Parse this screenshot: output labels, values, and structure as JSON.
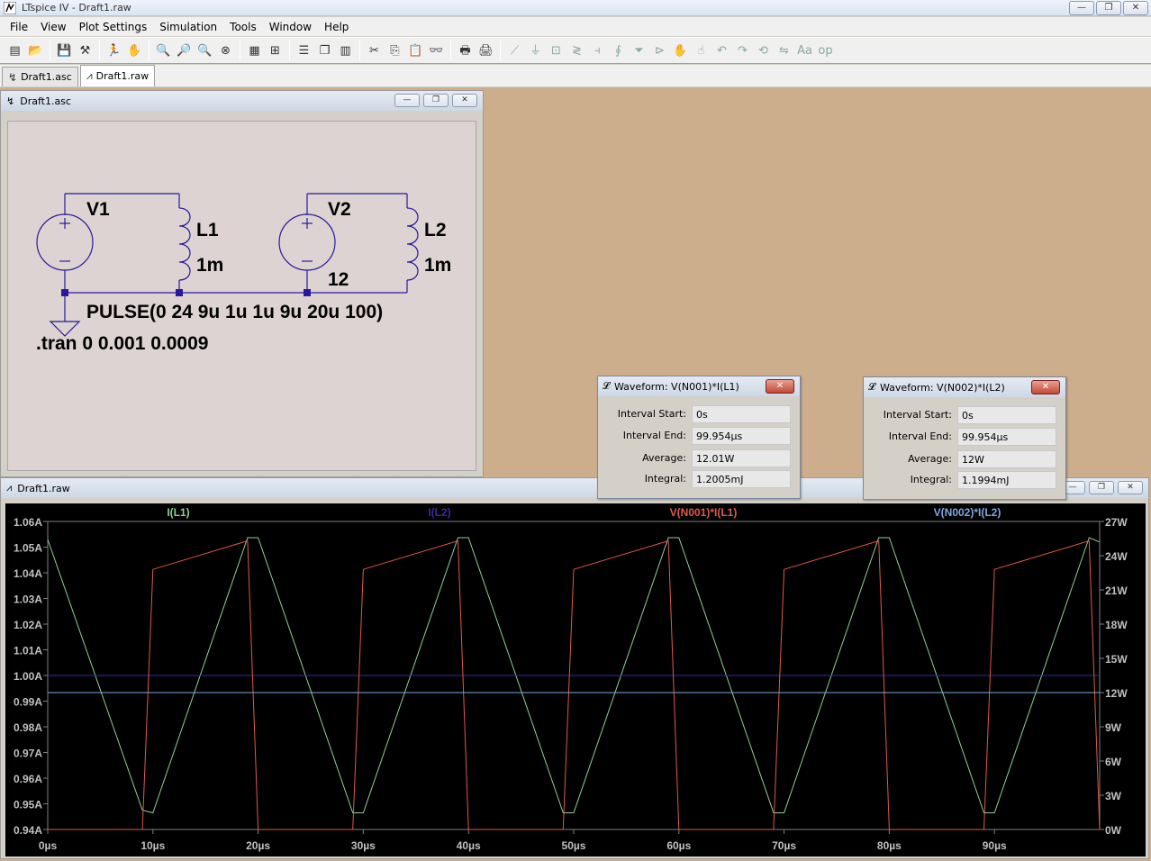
{
  "app": {
    "title": "LTspice IV - Draft1.raw",
    "window_buttons": [
      "—",
      "❐",
      "✕"
    ]
  },
  "menu": {
    "items": [
      "File",
      "View",
      "Plot Settings",
      "Simulation",
      "Tools",
      "Window",
      "Help"
    ]
  },
  "toolbar": {
    "icons": [
      {
        "name": "new-schematic-icon",
        "glyph": "▤"
      },
      {
        "name": "open-icon",
        "glyph": "📂"
      },
      {
        "name": "save-icon",
        "glyph": "💾"
      },
      {
        "name": "control-panel-icon",
        "glyph": "⚒"
      },
      {
        "name": "run-icon",
        "glyph": "🏃"
      },
      {
        "name": "pan-icon",
        "glyph": "✋"
      },
      {
        "name": "zoom-in-icon",
        "glyph": "🔍"
      },
      {
        "name": "zoom-area-icon",
        "glyph": "🔎"
      },
      {
        "name": "zoom-out-icon",
        "glyph": "🔍"
      },
      {
        "name": "zoom-fit-icon",
        "glyph": "⊗"
      },
      {
        "name": "autorange-icon",
        "glyph": "▦"
      },
      {
        "name": "manual-limits-icon",
        "glyph": "⊞"
      },
      {
        "name": "tile-horizontal-icon",
        "glyph": "☰"
      },
      {
        "name": "cascade-icon",
        "glyph": "❐"
      },
      {
        "name": "tile-vertical-icon",
        "glyph": "▥"
      },
      {
        "name": "cut-icon",
        "glyph": "✂"
      },
      {
        "name": "copy-icon",
        "glyph": "⎘"
      },
      {
        "name": "paste-icon",
        "glyph": "📋"
      },
      {
        "name": "find-icon",
        "glyph": "👓"
      },
      {
        "name": "print-setup-icon",
        "glyph": "🖶"
      },
      {
        "name": "print-icon",
        "glyph": "🖨"
      },
      {
        "name": "wire-icon",
        "glyph": "⟋"
      },
      {
        "name": "ground-icon",
        "glyph": "⏚"
      },
      {
        "name": "label-net-icon",
        "glyph": "⊡"
      },
      {
        "name": "resistor-icon",
        "glyph": "≷"
      },
      {
        "name": "capacitor-icon",
        "glyph": "⫞"
      },
      {
        "name": "inductor-icon",
        "glyph": "∮"
      },
      {
        "name": "diode-icon",
        "glyph": "⏷"
      },
      {
        "name": "component-icon",
        "glyph": "⊳"
      },
      {
        "name": "move-icon",
        "glyph": "✋"
      },
      {
        "name": "drag-icon",
        "glyph": "☝"
      },
      {
        "name": "undo-icon",
        "glyph": "↶"
      },
      {
        "name": "redo-icon",
        "glyph": "↷"
      },
      {
        "name": "rotate-icon",
        "glyph": "⟲"
      },
      {
        "name": "mirror-icon",
        "glyph": "⇋"
      },
      {
        "name": "text-icon",
        "glyph": "Aa"
      },
      {
        "name": "spice-directive-icon",
        "glyph": "op"
      }
    ]
  },
  "tabs": [
    {
      "label": "Draft1.asc",
      "active": false
    },
    {
      "label": "Draft1.raw",
      "active": true
    }
  ],
  "schematic_window": {
    "title": "Draft1.asc",
    "labels": {
      "v1": "V1",
      "l1": "L1",
      "l1_value": "1m",
      "v2": "V2",
      "v2_value": "12",
      "l2": "L2",
      "l2_value": "1m",
      "pulse": "PULSE(0 24 9u 1u 1u 9u 20u 100)",
      "tran": ".tran 0 0.001 0.0009"
    }
  },
  "plot_window": {
    "title": "Draft1.raw",
    "colors": {
      "background": "#000000",
      "axis_text": "#c0c0c0",
      "i_l1": "#90d098",
      "i_l2": "#3a2aa0",
      "p1": "#e05a48",
      "p2": "#7ea8e0"
    }
  },
  "measure_dialogs": [
    {
      "title": "Waveform: V(N001)*I(L1)",
      "rows": [
        {
          "label": "Interval Start:",
          "value": "0s"
        },
        {
          "label": "Interval End:",
          "value": "99.954µs"
        },
        {
          "label": "Average:",
          "value": "12.01W"
        },
        {
          "label": "Integral:",
          "value": "1.2005mJ"
        }
      ]
    },
    {
      "title": "Waveform: V(N002)*I(L2)",
      "rows": [
        {
          "label": "Interval Start:",
          "value": "0s"
        },
        {
          "label": "Interval End:",
          "value": "99.954µs"
        },
        {
          "label": "Average:",
          "value": "12W"
        },
        {
          "label": "Integral:",
          "value": "1.1994mJ"
        }
      ]
    }
  ],
  "chart_data": {
    "type": "line",
    "title": "",
    "xlabel": "",
    "ylabel": "",
    "x_ticks": [
      "0µs",
      "10µs",
      "20µs",
      "30µs",
      "40µs",
      "50µs",
      "60µs",
      "70µs",
      "80µs",
      "90µs"
    ],
    "y_left_ticks": [
      "1.06A",
      "1.05A",
      "1.04A",
      "1.03A",
      "1.02A",
      "1.01A",
      "1.00A",
      "0.99A",
      "0.98A",
      "0.97A",
      "0.96A",
      "0.95A",
      "0.94A"
    ],
    "y_right_ticks": [
      "27W",
      "24W",
      "21W",
      "18W",
      "15W",
      "12W",
      "9W",
      "6W",
      "3W",
      "0W"
    ],
    "xlim_us": [
      0,
      100
    ],
    "ylim_left_A": [
      0.94,
      1.06
    ],
    "ylim_right_W": [
      0,
      27
    ],
    "legend_placement": "top",
    "series": [
      {
        "name": "I(L1)",
        "axis": "left",
        "unit": "A",
        "x_us": [
          0,
          9,
          10,
          19,
          20,
          29,
          30,
          39,
          40,
          49,
          50,
          59,
          60,
          69,
          70,
          79,
          80,
          89,
          90,
          99,
          100
        ],
        "values": [
          1.053,
          0.9475,
          0.9465,
          1.0537,
          1.0537,
          0.9465,
          0.9465,
          1.0537,
          1.0537,
          0.9465,
          0.9465,
          1.0537,
          1.0537,
          0.9465,
          0.9465,
          1.0537,
          1.0537,
          0.9465,
          0.9465,
          1.0537,
          1.052
        ]
      },
      {
        "name": "I(L2)",
        "axis": "left",
        "unit": "A",
        "x_us": [
          0,
          100
        ],
        "values": [
          1.0,
          1.0
        ]
      },
      {
        "name": "V(N001)*I(L1)",
        "axis": "right",
        "unit": "W",
        "x_us": [
          0,
          9,
          10,
          19,
          20,
          29,
          30,
          39,
          40,
          49,
          50,
          59,
          60,
          69,
          70,
          79,
          80,
          89,
          90,
          99,
          100
        ],
        "values": [
          0,
          0,
          22.8,
          25.3,
          0,
          0,
          22.8,
          25.3,
          0,
          0,
          22.8,
          25.3,
          0,
          0,
          22.8,
          25.3,
          0,
          0,
          22.8,
          25.3,
          0
        ]
      },
      {
        "name": "V(N002)*I(L2)",
        "axis": "right",
        "unit": "W",
        "x_us": [
          0,
          100
        ],
        "values": [
          12.0,
          12.0
        ]
      }
    ]
  }
}
